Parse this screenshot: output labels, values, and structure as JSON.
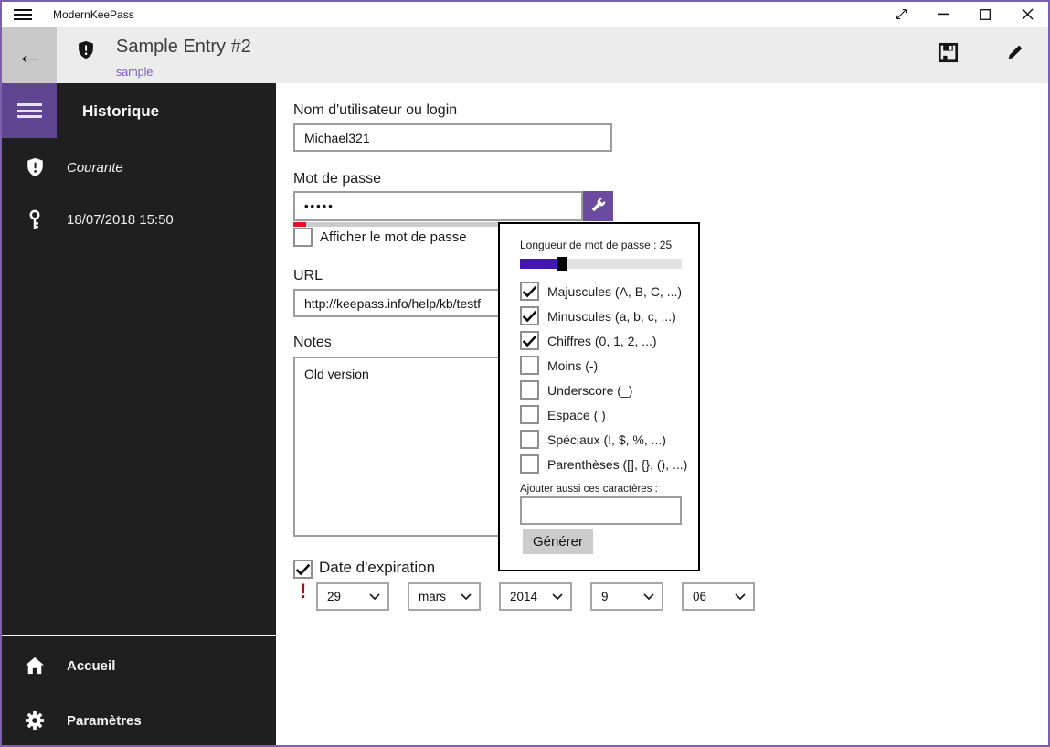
{
  "app": {
    "name": "ModernKeePass"
  },
  "icons": {
    "titlebar": [
      "hamburger-icon",
      "expand-icon",
      "minimize-icon",
      "maximize-icon",
      "close-icon"
    ],
    "header": [
      "back-arrow-icon",
      "shield-icon",
      "save-icon",
      "edit-pencil-icon"
    ],
    "sidebar": [
      "hamburger-icon",
      "shield-exclamation-icon",
      "key-icon",
      "home-icon",
      "gear-icon"
    ],
    "password": "wrench-icon"
  },
  "header": {
    "title": "Sample Entry #2",
    "subtitle": "sample"
  },
  "sidebar": {
    "heading": "Historique",
    "items": [
      {
        "label": "Courante"
      },
      {
        "label": "18/07/2018 15:50"
      }
    ],
    "footer": [
      {
        "label": "Accueil"
      },
      {
        "label": "Paramètres"
      }
    ]
  },
  "form": {
    "username_label": "Nom d'utilisateur ou login",
    "username_value": "Michael321",
    "password_label": "Mot de passe",
    "password_value": "•••••",
    "password_strength_percent": 4,
    "show_password_label": "Afficher le mot de passe",
    "show_password_checked": false,
    "url_label": "URL",
    "url_value": "http://keepass.info/help/kb/testf",
    "notes_label": "Notes",
    "notes_value": "Old version",
    "expiration_label": "Date d'expiration",
    "expiration_checked": true,
    "expiration_warning": "!",
    "date": {
      "day": "29",
      "month": "mars",
      "year": "2014",
      "hour": "9",
      "minute": "06"
    }
  },
  "generator": {
    "length_label": "Longueur de mot de passe : 25",
    "length_value": 25,
    "length_percent": 24,
    "options": [
      {
        "label": "Majuscules (A, B, C, ...)",
        "checked": true
      },
      {
        "label": "Minuscules (a, b, c, ...)",
        "checked": true
      },
      {
        "label": "Chiffres (0, 1, 2, ...)",
        "checked": true
      },
      {
        "label": "Moins (-)",
        "checked": false
      },
      {
        "label": "Underscore (_)",
        "checked": false
      },
      {
        "label": "Espace ( )",
        "checked": false
      },
      {
        "label": "Spéciaux (!, $, %, ...)",
        "checked": false
      },
      {
        "label": "Parenthèses ([], {}, (), ...)",
        "checked": false
      }
    ],
    "custom_label": "Ajouter aussi ces caractères :",
    "custom_value": "",
    "generate_button": "Générer"
  },
  "colors": {
    "window_border": "#7c5fb0",
    "accent_purple": "#604593",
    "button_purple": "#6a4b9e",
    "slider_purple": "#4417b2",
    "strength_red": "#e81123",
    "link_purple": "#7a5bbf",
    "warning_red": "#a01313",
    "sidebar_bg": "#1f1f1f",
    "header_bg": "#ececec"
  }
}
